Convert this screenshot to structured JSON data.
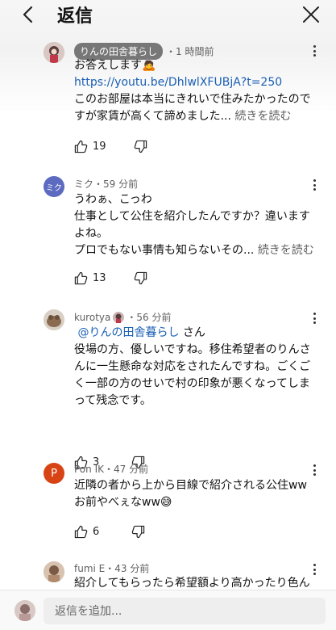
{
  "header": {
    "title": "返信"
  },
  "comments": [
    {
      "author_chip": "りんの田舎暮らし",
      "time": "・1 時間前",
      "line1": "お答えします🙇",
      "link": "https://youtu.be/DhlwlXFUBjA?t=250",
      "line2": "このお部屋は本当にきれいで住みたかったので",
      "line3_text": "すが家賃が高くて諦めました...",
      "more": "続きを読む",
      "likes": "19"
    },
    {
      "author": "ミク",
      "avatar_label": "ミク",
      "time": "・59 分前",
      "line1": "うわぁ、こっわ",
      "line2": "仕事として公住を紹介したんですか？違います",
      "line3": "よね。",
      "line4_text": "プロでもない事情も知らないその...",
      "more": "続きを読む",
      "likes": "13"
    },
    {
      "author": "kurotya",
      "time": "・56 分前",
      "mention": "@りんの田舎暮らし",
      "mention_suffix": "さん",
      "line1": "役場の方、優しいですね。移住希望者のりんさ",
      "line2": "んに一生懸命な対応をされたんですね。ごくご",
      "line3": "く一部の方のせいで村の印象が悪くなってしま",
      "line4": "って残念です。",
      "likes": "3"
    },
    {
      "author": "Pon IK",
      "avatar_label": "P",
      "time": "・47 分前",
      "line1": "近隣の者から上から目線で紹介される公住ww",
      "line2": "お前やべぇなww😅",
      "likes": "6"
    },
    {
      "author": "fumi E",
      "time": "・43 分前",
      "line1": "紹介してもらったら希望額より高かったり色ん"
    }
  ],
  "reply_box": {
    "placeholder": "返信を追加..."
  },
  "colors": {
    "link": "#1a5fb4",
    "chip_bg": "#777777",
    "avatar_miku": "#5c6bc0",
    "avatar_pon": "#d84315"
  }
}
